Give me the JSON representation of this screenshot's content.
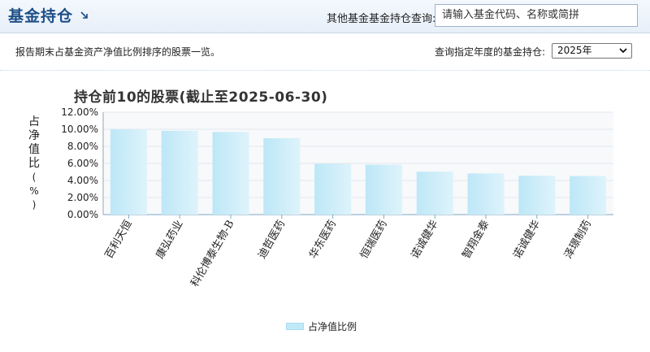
{
  "header": {
    "title": "基金持仓",
    "search_label": "其他基金基金持仓查询:",
    "search_placeholder": "请输入基金代码、名称或简拼"
  },
  "subbar": {
    "description": "报告期末占基金资产净值比例排序的股票一览。",
    "year_label": "查询指定年度的基金持仓:",
    "year_value": "2025年"
  },
  "colors": {
    "accent": "#1d4e86",
    "bar": "#c2e9f8"
  },
  "chart_data": {
    "type": "bar",
    "title": "持仓前10的股票(截止至2025-06-30)",
    "ylabel": "占净值比(%)",
    "xlabel": "",
    "categories": [
      "百利天恒",
      "康弘药业",
      "科伦博泰生物-B",
      "迪哲医药",
      "华东医药",
      "恒瑞医药",
      "诺诚健华",
      "智翔金泰",
      "诺诚健华",
      "泽璟制药"
    ],
    "values": [
      9.98,
      9.82,
      9.68,
      8.95,
      5.95,
      5.84,
      5.03,
      4.82,
      4.55,
      4.52
    ],
    "ylim": [
      0,
      12
    ],
    "yticks": [
      "0.00%",
      "2.00%",
      "4.00%",
      "6.00%",
      "8.00%",
      "10.00%",
      "12.00%"
    ],
    "legend": [
      "占净值比例"
    ],
    "legend_position": "bottom",
    "grid": true
  }
}
